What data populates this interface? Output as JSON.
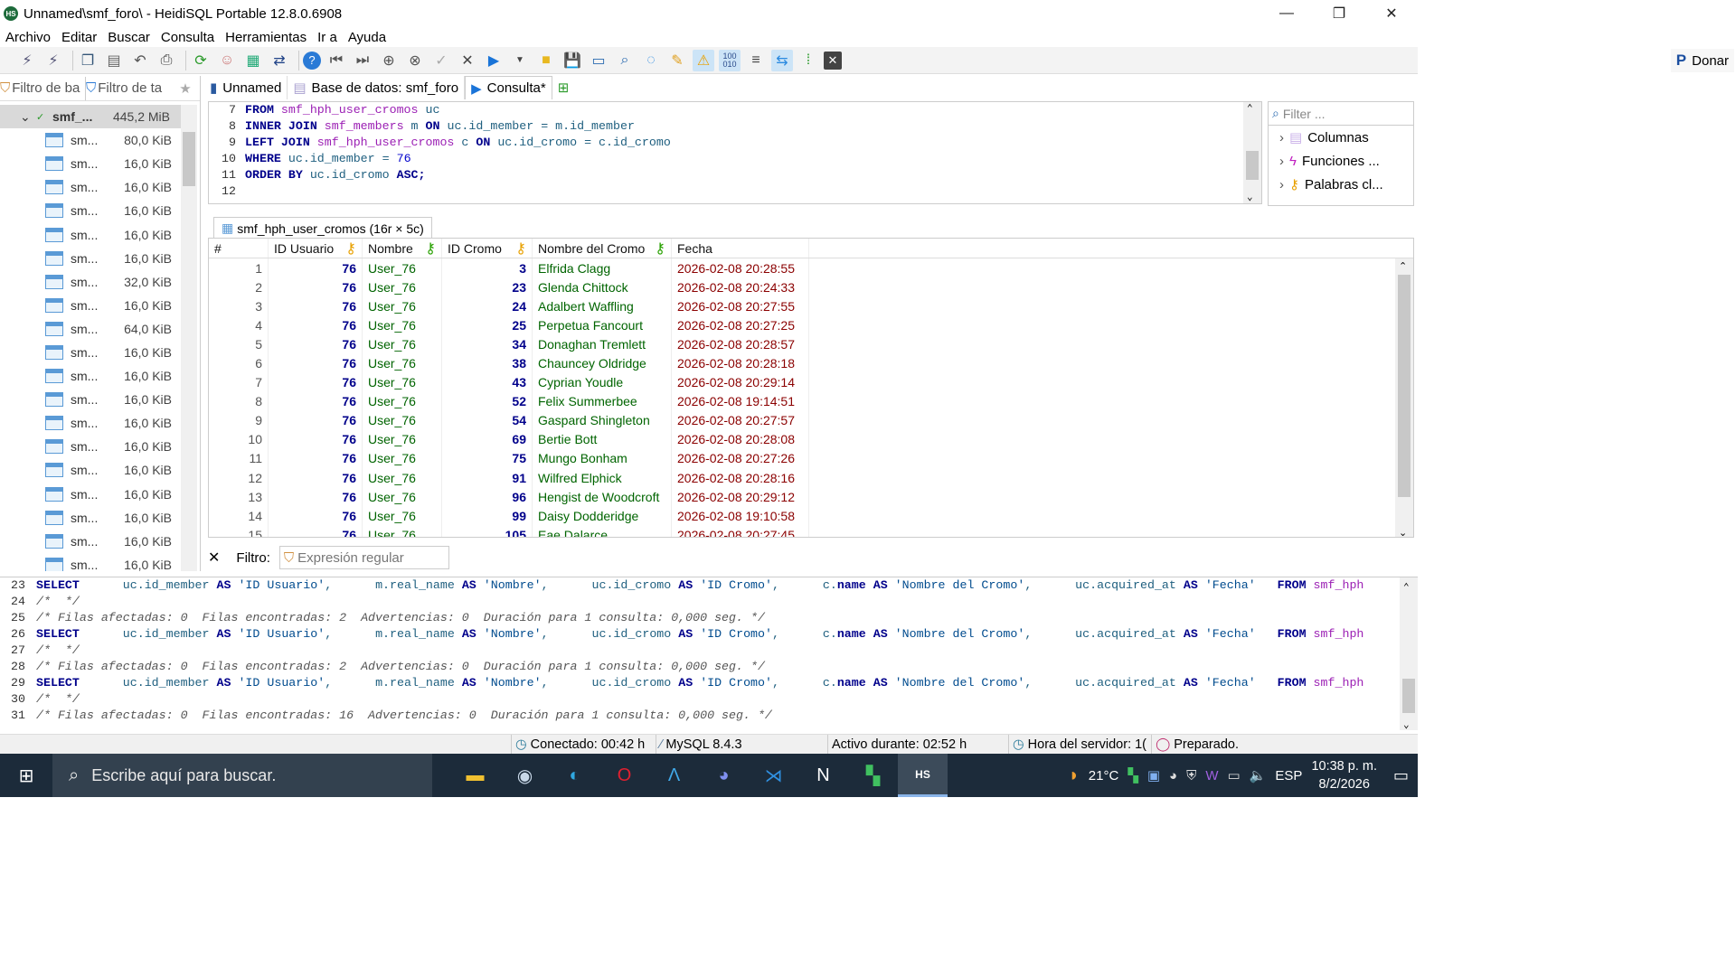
{
  "window": {
    "title": "Unnamed\\smf_foro\\ - HeidiSQL Portable 12.8.0.6908",
    "app_icon": "HS",
    "minimize": "—",
    "restore": "❐",
    "close": "✕"
  },
  "menu": [
    "Archivo",
    "Editar",
    "Buscar",
    "Consulta",
    "Herramientas",
    "Ir a",
    "Ayuda"
  ],
  "toolbar": {
    "donate_label": "Donar",
    "icons": [
      "connect-icon",
      "disconnect-icon",
      "copy-icon",
      "paste-icon",
      "undo-icon",
      "print-icon",
      "refresh-icon",
      "users-icon",
      "export-icon",
      "transfer-icon",
      "help-icon",
      "first-icon",
      "last-icon",
      "add-icon",
      "cancel-icon",
      "apply-icon",
      "delete-icon",
      "run-icon",
      "open-icon",
      "save-icon",
      "load-icon",
      "find-icon",
      "replace-icon",
      "clean-icon",
      "warn-icon",
      "binary-icon",
      "wrap-icon",
      "sync-icon",
      "log-icon",
      "close-tab-icon"
    ]
  },
  "left_panel": {
    "filter_db_placeholder": "Filtro de ba",
    "filter_table_placeholder": "Filtro de ta",
    "root": {
      "name": "smf_...",
      "size": "445,2 MiB"
    },
    "tables": [
      {
        "name": "sm...",
        "size": "80,0 KiB"
      },
      {
        "name": "sm...",
        "size": "16,0 KiB"
      },
      {
        "name": "sm...",
        "size": "16,0 KiB"
      },
      {
        "name": "sm...",
        "size": "16,0 KiB"
      },
      {
        "name": "sm...",
        "size": "16,0 KiB"
      },
      {
        "name": "sm...",
        "size": "16,0 KiB"
      },
      {
        "name": "sm...",
        "size": "32,0 KiB"
      },
      {
        "name": "sm...",
        "size": "16,0 KiB"
      },
      {
        "name": "sm...",
        "size": "64,0 KiB"
      },
      {
        "name": "sm...",
        "size": "16,0 KiB"
      },
      {
        "name": "sm...",
        "size": "16,0 KiB"
      },
      {
        "name": "sm...",
        "size": "16,0 KiB"
      },
      {
        "name": "sm...",
        "size": "16,0 KiB"
      },
      {
        "name": "sm...",
        "size": "16,0 KiB"
      },
      {
        "name": "sm...",
        "size": "16,0 KiB"
      },
      {
        "name": "sm...",
        "size": "16,0 KiB"
      },
      {
        "name": "sm...",
        "size": "16,0 KiB"
      },
      {
        "name": "sm...",
        "size": "16,0 KiB"
      },
      {
        "name": "sm...",
        "size": "16,0 KiB"
      }
    ]
  },
  "tabs": {
    "host": "Unnamed",
    "database": "Base de datos: smf_foro",
    "query": "Consulta*"
  },
  "editor": {
    "lines": [
      {
        "n": "7",
        "code": [
          [
            "kw",
            "FROM "
          ],
          [
            "id",
            "smf_hph_user_cromos "
          ],
          [
            "plain",
            "uc"
          ]
        ]
      },
      {
        "n": "8",
        "code": [
          [
            "kw",
            "INNER JOIN "
          ],
          [
            "id",
            "smf_members "
          ],
          [
            "plain",
            "m "
          ],
          [
            "kw",
            "ON "
          ],
          [
            "plain",
            "uc.id_member = m.id_member"
          ]
        ]
      },
      {
        "n": "9",
        "code": [
          [
            "kw",
            "LEFT JOIN "
          ],
          [
            "id",
            "smf_hph_user_cromos "
          ],
          [
            "plain",
            "c "
          ],
          [
            "kw",
            "ON "
          ],
          [
            "plain",
            "uc.id_cromo = c.id_cromo"
          ]
        ]
      },
      {
        "n": "10",
        "code": [
          [
            "kw",
            "WHERE "
          ],
          [
            "plain",
            "uc.id_member = "
          ],
          [
            "num",
            "76"
          ]
        ]
      },
      {
        "n": "11",
        "code": [
          [
            "kw",
            "ORDER BY "
          ],
          [
            "plain",
            "uc.id_cromo "
          ],
          [
            "kw",
            "ASC;"
          ]
        ]
      },
      {
        "n": "12",
        "code": []
      }
    ]
  },
  "helpers": {
    "filter_placeholder": "Filter ...",
    "items": [
      "Columnas",
      "Funciones ...",
      "Palabras cl..."
    ]
  },
  "result": {
    "tab_label": "smf_hph_user_cromos (16r × 5c)",
    "columns": [
      "#",
      "ID Usuario",
      "Nombre",
      "ID Cromo",
      "Nombre del Cromo",
      "Fecha"
    ],
    "rows": [
      [
        "1",
        "76",
        "User_76",
        "3",
        "Elfrida Clagg",
        "2026-02-08 20:28:55"
      ],
      [
        "2",
        "76",
        "User_76",
        "23",
        "Glenda Chittock",
        "2026-02-08 20:24:33"
      ],
      [
        "3",
        "76",
        "User_76",
        "24",
        "Adalbert Waffling",
        "2026-02-08 20:27:55"
      ],
      [
        "4",
        "76",
        "User_76",
        "25",
        "Perpetua Fancourt",
        "2026-02-08 20:27:25"
      ],
      [
        "5",
        "76",
        "User_76",
        "34",
        "Donaghan Tremlett",
        "2026-02-08 20:28:57"
      ],
      [
        "6",
        "76",
        "User_76",
        "38",
        "Chauncey Oldridge",
        "2026-02-08 20:28:18"
      ],
      [
        "7",
        "76",
        "User_76",
        "43",
        "Cyprian Youdle",
        "2026-02-08 20:29:14"
      ],
      [
        "8",
        "76",
        "User_76",
        "52",
        "Felix Summerbee",
        "2026-02-08 19:14:51"
      ],
      [
        "9",
        "76",
        "User_76",
        "54",
        "Gaspard Shingleton",
        "2026-02-08 20:27:57"
      ],
      [
        "10",
        "76",
        "User_76",
        "69",
        "Bertie Bott",
        "2026-02-08 20:28:08"
      ],
      [
        "11",
        "76",
        "User_76",
        "75",
        "Mungo Bonham",
        "2026-02-08 20:27:26"
      ],
      [
        "12",
        "76",
        "User_76",
        "91",
        "Wilfred Elphick",
        "2026-02-08 20:28:16"
      ],
      [
        "13",
        "76",
        "User_76",
        "96",
        "Hengist de Woodcroft",
        "2026-02-08 20:29:12"
      ],
      [
        "14",
        "76",
        "User_76",
        "99",
        "Daisy Dodderidge",
        "2026-02-08 19:10:58"
      ],
      [
        "15",
        "76",
        "User_76",
        "105",
        "Eae Dalarce",
        "2026-02-08 20:27:45"
      ]
    ]
  },
  "filter_bar": {
    "label": "Filtro:",
    "placeholder": "Expresión regular"
  },
  "log": {
    "lines": [
      {
        "n": "23",
        "type": "select"
      },
      {
        "n": "24",
        "type": "comment",
        "text": "/*  */"
      },
      {
        "n": "25",
        "type": "comment",
        "text": "/* Filas afectadas: 0  Filas encontradas: 2  Advertencias: 0  Duración para 1 consulta: 0,000 seg. */"
      },
      {
        "n": "26",
        "type": "select"
      },
      {
        "n": "27",
        "type": "comment",
        "text": "/*  */"
      },
      {
        "n": "28",
        "type": "comment",
        "text": "/* Filas afectadas: 0  Filas encontradas: 2  Advertencias: 0  Duración para 1 consulta: 0,000 seg. */"
      },
      {
        "n": "29",
        "type": "select"
      },
      {
        "n": "30",
        "type": "comment",
        "text": "/*  */"
      },
      {
        "n": "31",
        "type": "comment",
        "text": "/* Filas afectadas: 0  Filas encontradas: 16  Advertencias: 0  Duración para 1 consulta: 0,000 seg. */"
      }
    ],
    "select_parts": [
      [
        "kw",
        "SELECT"
      ],
      [
        "plain",
        "      uc.id_member "
      ],
      [
        "kw",
        "AS "
      ],
      [
        "str",
        "'ID Usuario'"
      ],
      [
        "plain",
        ",      m.real_name "
      ],
      [
        "kw",
        "AS "
      ],
      [
        "str",
        "'Nombre'"
      ],
      [
        "plain",
        ",      uc.id_cromo "
      ],
      [
        "kw",
        "AS "
      ],
      [
        "str",
        "'ID Cromo'"
      ],
      [
        "plain",
        ",      c."
      ],
      [
        "kw",
        "name "
      ],
      [
        "kw",
        "AS "
      ],
      [
        "str",
        "'Nombre del Cromo'"
      ],
      [
        "plain",
        ",      uc.acquired_at "
      ],
      [
        "kw",
        "AS "
      ],
      [
        "str",
        "'Fecha'"
      ],
      [
        "plain",
        "   "
      ],
      [
        "kw",
        "FROM "
      ],
      [
        "id",
        "smf_hph"
      ]
    ]
  },
  "status": {
    "connected": "Conectado: 00:42 h",
    "server": "MySQL 8.4.3",
    "uptime": "Activo durante: 02:52 h",
    "server_time": "Hora del servidor: 1(",
    "state": "Preparado."
  },
  "taskbar": {
    "search_placeholder": "Escribe aquí para buscar.",
    "weather": "21°C",
    "language": "ESP",
    "time": "10:38 p. m.",
    "date": "8/2/2026"
  },
  "colors": {
    "accent": "#1d6b3b",
    "keyword": "#00008b",
    "identifier": "#9b1fb4"
  }
}
